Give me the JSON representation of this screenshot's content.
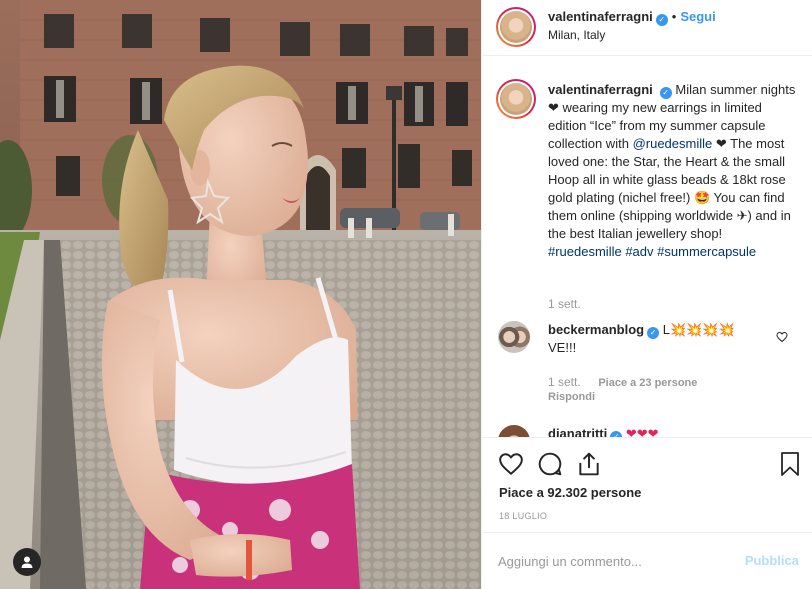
{
  "post": {
    "username": "valentinaferragni",
    "follow_label": "Segui",
    "separator": "•",
    "location": "Milan, Italy",
    "caption_before_mention": "Milan summer nights ❤ wearing my new earrings in limited edition “Ice” from my summer capsule collection with",
    "mention": "@ruedesmille",
    "caption_after_mention": "❤ The most loved one: the Star, the Heart & the small Hoop all in white glass beads & 18kt rose gold plating (nichel free!) 🤩 You can find them online (shipping worldwide ✈) and in the best Italian jewellery shop!",
    "hashtags": [
      "#ruedesmille",
      "#adv",
      "#summercapsule"
    ],
    "caption_time": "1 sett."
  },
  "comments": [
    {
      "username": "beckermanblog",
      "text": "L💥💥💥💥 VE!!!",
      "time": "1 sett.",
      "likes": "Piace a 23 persone",
      "reply_label": "Rispondi"
    },
    {
      "username": "dianatritti",
      "text": "❤❤❤"
    }
  ],
  "actions": {
    "like_icon": "heart-outline-icon",
    "comment_icon": "comment-bubble-icon",
    "share_icon": "share-icon",
    "save_icon": "bookmark-icon",
    "likes_text": "Piace a 92.302 persone",
    "date": "18 LUGLIO"
  },
  "add_comment": {
    "placeholder": "Aggiungi un commento...",
    "publish_label": "Pubblica"
  },
  "colors": {
    "accent": "#3897f0",
    "link": "#003569",
    "muted": "#999999",
    "publish_disabled": "#b2dffc"
  }
}
